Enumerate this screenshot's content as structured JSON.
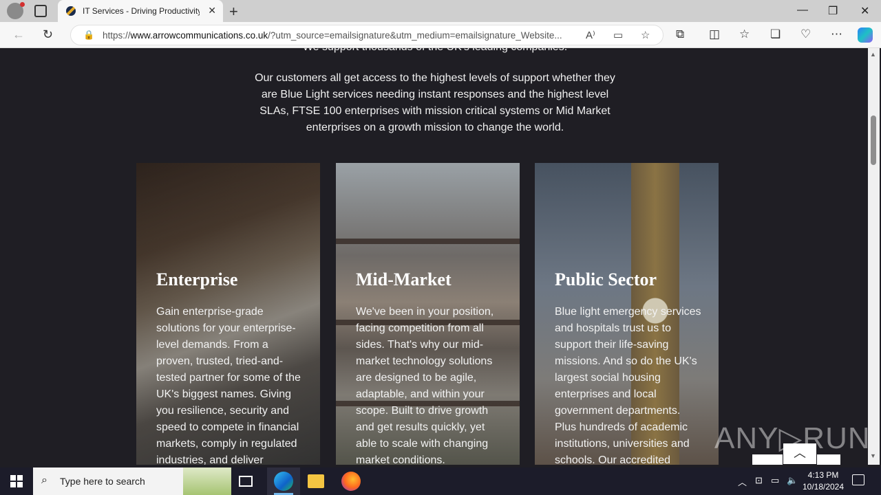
{
  "browser": {
    "tab_title": "IT Services - Driving Productivity",
    "tab_close": "✕",
    "new_tab": "+",
    "minimize": "—",
    "restore": "❐",
    "close": "✕",
    "url_domain": "www.arrowcommunications.co.uk",
    "url_prefix": "https://",
    "url_rest": "/?utm_source=emailsignature&utm_medium=emailsignature_Website..."
  },
  "page": {
    "intro_top": "We support thousands of the UK's leading companies.",
    "intro": "Our customers all get access to the highest levels of support whether they are Blue Light services needing instant responses and the highest level SLAs, FTSE 100 enterprises with mission critical systems or Mid Market enterprises on a growth mission to change the world.",
    "cards": [
      {
        "title": "Enterprise",
        "text": "Gain enterprise-grade solutions for your enterprise-level demands. From a proven, trusted, tried-and-tested partner for some of the UK's biggest names. Giving you resilience, security and speed to compete in financial markets, comply in regulated industries, and deliver"
      },
      {
        "title": "Mid-Market",
        "text": "We've been in your position, facing competition from all sides. That's why our mid-market technology solutions are designed to be agile, adaptable, and within your scope. Built to drive growth and get results quickly, yet able to scale with changing market conditions."
      },
      {
        "title": "Public Sector",
        "text": "Blue light emergency services and hospitals trust us to support their life-saving missions. And so do the UK's largest social housing enterprises and local government departments. Plus hundreds of academic institutions, universities and schools. Our accredited"
      }
    ],
    "watermark": "ANY▷RUN",
    "back_to_top": "︿"
  },
  "taskbar": {
    "search_placeholder": "Type here to search",
    "time": "4:13 PM",
    "date": "10/18/2024"
  },
  "icons": {
    "back": "back-arrow-icon",
    "refresh": "refresh-icon",
    "lock": "lock-icon",
    "read_aloud": "read-aloud-icon",
    "immersive": "immersive-reader-icon",
    "favorite": "star-icon",
    "extensions": "extensions-icon",
    "split": "split-screen-icon",
    "favorites": "favorites-icon",
    "collections": "collections-icon",
    "performance": "browser-essentials-icon",
    "more": "more-icon",
    "copilot": "copilot-icon"
  }
}
